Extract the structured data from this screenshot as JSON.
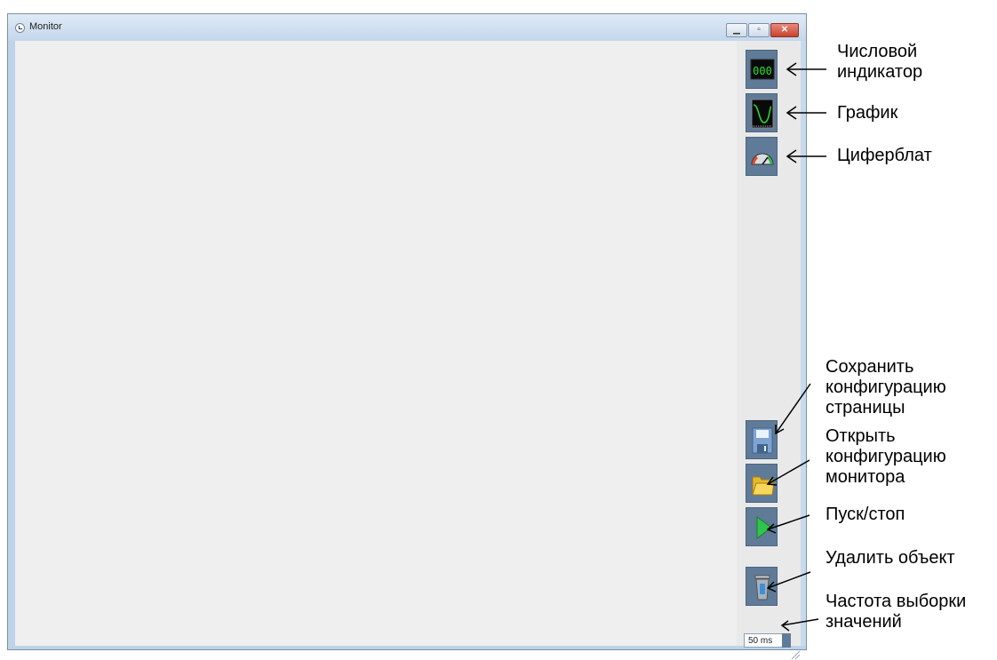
{
  "window": {
    "title": "Monitor"
  },
  "window_controls": [
    "minimize",
    "maximize",
    "close"
  ],
  "toolbar": {
    "items": [
      {
        "icon": "digital-indicator-icon",
        "label": "Числовой индикатор"
      },
      {
        "icon": "graph-icon",
        "label": "График"
      },
      {
        "icon": "dial-icon",
        "label": "Циферблат"
      },
      {
        "icon": "save-icon",
        "label": "Сохранить конфигурацию страницы"
      },
      {
        "icon": "open-folder-icon",
        "label": "Открыть конфигурацию монитора"
      },
      {
        "icon": "play-icon",
        "label": "Пуск/стоп"
      },
      {
        "icon": "trash-icon",
        "label": "Удалить объект"
      }
    ],
    "sampling_rate": {
      "value": "50 ms",
      "label": "Частота выборки значений"
    }
  },
  "callouts": {
    "digital": "Числовой\nиндикатор",
    "graph": "График",
    "dial": "Циферблат",
    "save": "Сохранить\nконфигурацию\nстраницы",
    "open": "Открыть\nконфигурацию\nмонитора",
    "play": "Пуск/стоп",
    "delete": "Удалить объект",
    "rate": "Частота выборки\nзначений"
  },
  "colors": {
    "tool_bg": "#5f7b98",
    "digital_green": "#2ee02e",
    "close_red": "#c6432d"
  }
}
